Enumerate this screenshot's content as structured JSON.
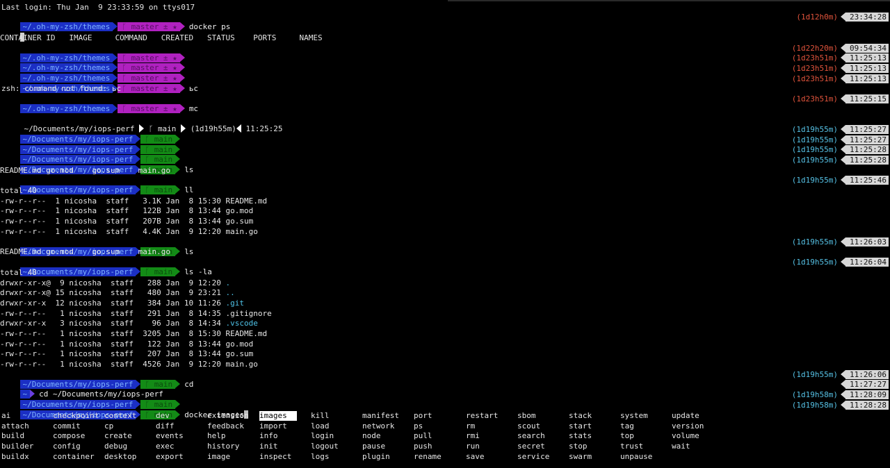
{
  "terminal": {
    "last_login": "Last login: Thu Jan  9 23:33:59 on ttys017",
    "omz_path": "~/.oh-my-zsh/themes",
    "omz_branch": "master ± ★",
    "branch_icon": "ᚴ",
    "iops_path": "~/Documents/my/iops-perf",
    "iops_branch": "main",
    "home_path": "~",
    "cmd_docker_ps": "docker ps",
    "docker_ps_header": "CONTAINER ID   IMAGE     COMMAND   CREATED   STATUS    PORTS     NAMES",
    "cmd_bc": "ьс",
    "bc_error": "zsh: command not found: ьс",
    "cmd_mc": "mc",
    "cmd_ls": "ls",
    "cmd_ll": "ll",
    "cmd_ls_la": "ls -la",
    "cmd_cd": "cd",
    "cmd_cd_full": "cd ~/Documents/my/iops-perf",
    "cmd_docker_images": "docker images",
    "ls_output": "README.md go.mod    go.sum    main.go",
    "p10_elapsed": "(1d19h55m)",
    "p10_time": "11:25:25",
    "ll_total": "total 40",
    "ll_rows": [
      "-rw-r--r--  1 nicosha  staff   3.1K Jan  8 15:30 README.md",
      "-rw-r--r--  1 nicosha  staff   122B Jan  8 13:44 go.mod",
      "-rw-r--r--  1 nicosha  staff   207B Jan  8 13:44 go.sum",
      "-rw-r--r--  1 nicosha  staff   4.4K Jan  9 12:20 main.go"
    ],
    "la_total": "total 48",
    "la_rows": [
      {
        "prefix": "drwxr-xr-x@  9 nicosha  staff   288 Jan  9 12:20 ",
        "name": ".",
        "dir": true
      },
      {
        "prefix": "drwxr-xr-x@ 15 nicosha  staff   480 Jan  9 23:21 ",
        "name": "..",
        "dir": true
      },
      {
        "prefix": "drwxr-xr-x  12 nicosha  staff   384 Jan 10 11:26 ",
        "name": ".git",
        "dir": true
      },
      {
        "prefix": "-rw-r--r--   1 nicosha  staff   291 Jan  8 14:35 ",
        "name": ".gitignore",
        "dir": false
      },
      {
        "prefix": "drwxr-xr-x   3 nicosha  staff    96 Jan  8 14:34 ",
        "name": ".vscode",
        "dir": true
      },
      {
        "prefix": "-rw-r--r--   1 nicosha  staff  3205 Jan  8 15:30 ",
        "name": "README.md",
        "dir": false
      },
      {
        "prefix": "-rw-r--r--   1 nicosha  staff   122 Jan  8 13:44 ",
        "name": "go.mod",
        "dir": false
      },
      {
        "prefix": "-rw-r--r--   1 nicosha  staff   207 Jan  8 13:44 ",
        "name": "go.sum",
        "dir": false
      },
      {
        "prefix": "-rw-r--r--   1 nicosha  staff  4526 Jan  9 12:20 ",
        "name": "main.go",
        "dir": false
      }
    ],
    "right_prompts": [
      {
        "elapsed": "(1d12h0m)",
        "time": "23:34:28",
        "color": "red"
      },
      {
        "elapsed": "(1d22h20m)",
        "time": "09:54:34",
        "color": "red"
      },
      {
        "elapsed": "(1d23h51m)",
        "time": "11:25:13",
        "color": "red"
      },
      {
        "elapsed": "(1d23h51m)",
        "time": "11:25:13",
        "color": "red"
      },
      {
        "elapsed": "(1d23h51m)",
        "time": "11:25:13",
        "color": "red"
      },
      {
        "elapsed": "(1d23h51m)",
        "time": "11:25:15",
        "color": "red"
      },
      {
        "elapsed": "(1d19h55m)",
        "time": "11:25:27",
        "color": "cyan"
      },
      {
        "elapsed": "(1d19h55m)",
        "time": "11:25:27",
        "color": "cyan"
      },
      {
        "elapsed": "(1d19h55m)",
        "time": "11:25:28",
        "color": "cyan"
      },
      {
        "elapsed": "(1d19h55m)",
        "time": "11:25:28",
        "color": "cyan"
      },
      {
        "elapsed": "(1d19h55m)",
        "time": "11:25:46",
        "color": "cyan"
      },
      {
        "elapsed": "(1d19h55m)",
        "time": "11:26:03",
        "color": "cyan"
      },
      {
        "elapsed": "(1d19h55m)",
        "time": "11:26:04",
        "color": "cyan"
      },
      {
        "elapsed": "(1d19h55m)",
        "time": "11:26:06",
        "color": "cyan"
      },
      {
        "elapsed": "",
        "time": "11:27:27",
        "color": "cyan"
      },
      {
        "elapsed": "(1d19h58m)",
        "time": "11:28:09",
        "color": "cyan"
      },
      {
        "elapsed": "(1d19h58m)",
        "time": "11:28:28",
        "color": "cyan"
      }
    ],
    "completions": [
      [
        "ai",
        "checkpoint",
        "context",
        "dev",
        "extension",
        "images",
        "kill",
        "manifest",
        "port",
        "restart",
        "sbom",
        "stack",
        "system",
        "update"
      ],
      [
        "attach",
        "commit",
        "cp",
        "diff",
        "feedback",
        "import",
        "load",
        "network",
        "ps",
        "rm",
        "scout",
        "start",
        "tag",
        "version"
      ],
      [
        "build",
        "compose",
        "create",
        "events",
        "help",
        "info",
        "login",
        "node",
        "pull",
        "rmi",
        "search",
        "stats",
        "top",
        "volume"
      ],
      [
        "builder",
        "config",
        "debug",
        "exec",
        "history",
        "init",
        "logout",
        "pause",
        "push",
        "run",
        "secret",
        "stop",
        "trust",
        "wait"
      ],
      [
        "buildx",
        "container",
        "desktop",
        "export",
        "image",
        "inspect",
        "logs",
        "plugin",
        "rename",
        "save",
        "service",
        "swarm",
        "unpause",
        ""
      ]
    ],
    "selected_completion": "images",
    "colors": {
      "background": "#000000",
      "blue_segment": "#1b2fc4",
      "magenta_segment": "#b021c0",
      "green_segment": "#138b16",
      "elapsed_red": "#e2543c",
      "elapsed_cyan": "#56c2e6",
      "time_box": "#d7d7d7",
      "dir_cyan": "#4fc3e8"
    }
  }
}
